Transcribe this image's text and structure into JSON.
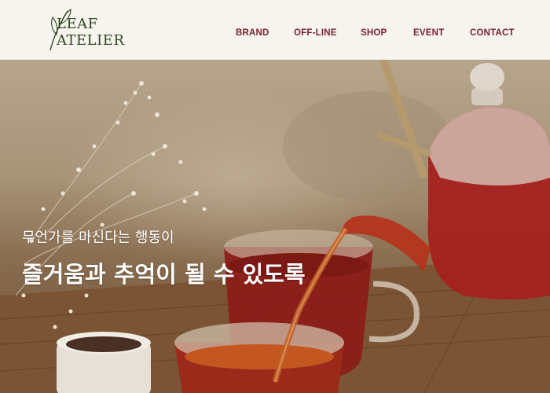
{
  "header": {
    "logo": {
      "line1": "LEAF",
      "line2": "ATELIER"
    },
    "nav": [
      {
        "label": "BRAND",
        "name": "nav-brand"
      },
      {
        "label": "OFF-LINE",
        "name": "nav-offline"
      },
      {
        "label": "SHOP",
        "name": "nav-shop"
      },
      {
        "label": "EVENT",
        "name": "nav-event"
      },
      {
        "label": "CONTACT",
        "name": "nav-contact"
      }
    ]
  },
  "hero": {
    "line1": "무언가를 마신다는 행동이",
    "line2": "즐거움과 추억이 될 수 있도록"
  },
  "colors": {
    "nav_text": "#7a2230",
    "logo": "#2f4a24",
    "header_bg": "#f7f3ee",
    "tea": "#9b1f1c"
  }
}
